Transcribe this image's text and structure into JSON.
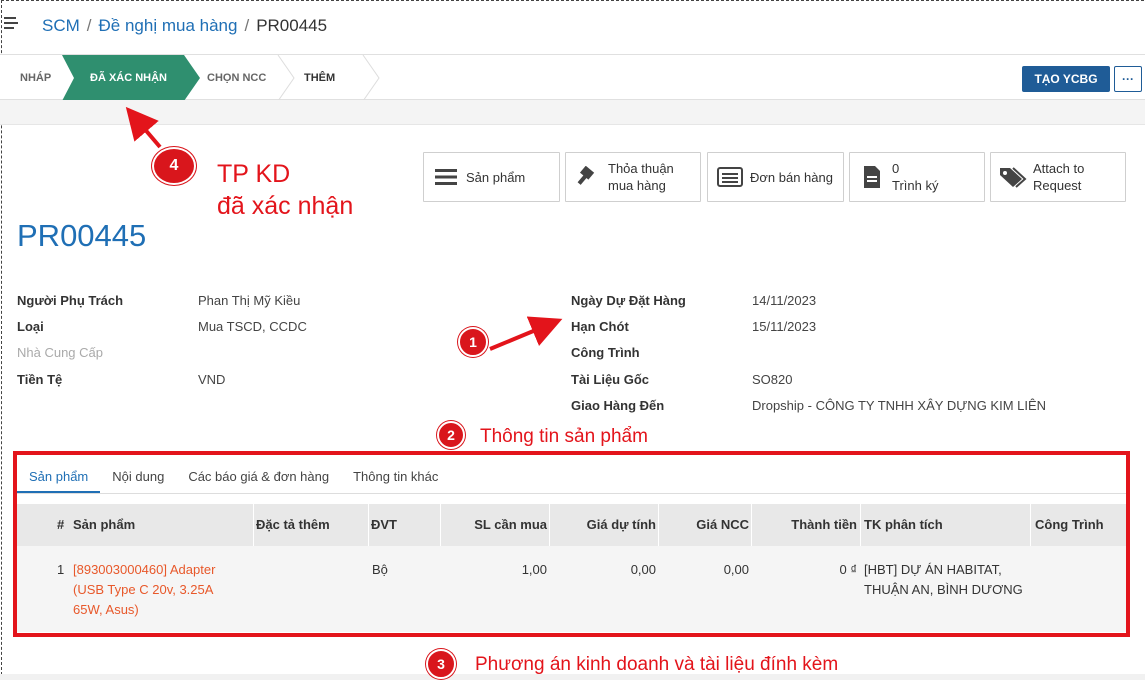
{
  "breadcrumb": {
    "app": "SCM",
    "section": "Đề nghị mua hàng",
    "current": "PR00445",
    "separator": "/"
  },
  "statusbar": {
    "stages": [
      {
        "label": "NHÁP",
        "active": false
      },
      {
        "label": "ĐÃ XÁC NHẬN",
        "active": true
      },
      {
        "label": "CHỌN NCC",
        "active": false
      },
      {
        "label": "THÊM",
        "active": false
      }
    ],
    "primary_button": "TẠO YCBG",
    "more_button": "···",
    "active_color": "#2f8f6f"
  },
  "smart_buttons": {
    "products": {
      "label": "Sản phẩm",
      "icon": "list-icon"
    },
    "agreement": {
      "line1": "Thỏa thuận",
      "line2": "mua hàng",
      "icon": "gavel-icon"
    },
    "sales_order": {
      "label": "Đơn bán hàng",
      "icon": "receipt-icon"
    },
    "approval": {
      "count": "0",
      "label": "Trình ký",
      "icon": "document-icon"
    },
    "attach": {
      "line1": "Attach to",
      "line2": "Request",
      "icon": "tags-icon"
    }
  },
  "record": {
    "title": "PR00445"
  },
  "fields": {
    "left": [
      {
        "label": "Người Phụ Trách",
        "value": "Phan Thị Mỹ Kiều",
        "muted": false
      },
      {
        "label": "Loại",
        "value": "Mua TSCD, CCDC",
        "muted": false
      },
      {
        "label": "Nhà Cung Cấp",
        "value": "",
        "muted": true
      },
      {
        "label": "Tiền Tệ",
        "value": "VND",
        "muted": false
      }
    ],
    "right": [
      {
        "label": "Ngày Dự Đặt Hàng",
        "value": "14/11/2023"
      },
      {
        "label": "Hạn Chót",
        "value": "15/11/2023"
      },
      {
        "label": "Công Trình",
        "value": ""
      },
      {
        "label": "Tài Liệu Gốc",
        "value": "SO820"
      },
      {
        "label": "Giao Hàng Đến",
        "value": "Dropship - CÔNG TY TNHH XÂY DỰNG KIM LIÊN"
      }
    ]
  },
  "tabs": [
    {
      "label": "Sản phẩm",
      "active": true
    },
    {
      "label": "Nội dung",
      "active": false
    },
    {
      "label": "Các báo giá & đơn hàng",
      "active": false
    },
    {
      "label": "Thông tin khác",
      "active": false
    }
  ],
  "table": {
    "headers": {
      "num": "#",
      "product": "Sản phẩm",
      "spec": "Đặc tả thêm",
      "uom": "ĐVT",
      "qty": "SL cần mua",
      "est_price": "Giá dự tính",
      "vendor_price": "Giá NCC",
      "total": "Thành tiền",
      "analytic": "TK phân tích",
      "project": "Công Trình"
    },
    "rows": [
      {
        "num": "1",
        "product_l1": "[893003000460] Adapter",
        "product_l2": "(USB Type C 20v, 3.25A",
        "product_l3": "65W, Asus)",
        "spec": "",
        "uom": "Bộ",
        "qty": "1,00",
        "est_price": "0,00",
        "vendor_price": "0,00",
        "total": "0 ₫",
        "analytic_l1": "[HBT] DỰ ÁN HABITAT,",
        "analytic_l2": "THUẬN AN, BÌNH DƯƠNG",
        "project": ""
      }
    ]
  },
  "annotations": {
    "a1": {
      "num": "1"
    },
    "a2": {
      "num": "2",
      "text": "Thông tin sản phẩm"
    },
    "a3": {
      "num": "3",
      "text": "Phương án kinh doanh và tài liệu đính kèm"
    },
    "a4": {
      "num": "4",
      "line1": "TP KD",
      "line2": "đã xác nhận"
    },
    "color": "#e3141b"
  }
}
